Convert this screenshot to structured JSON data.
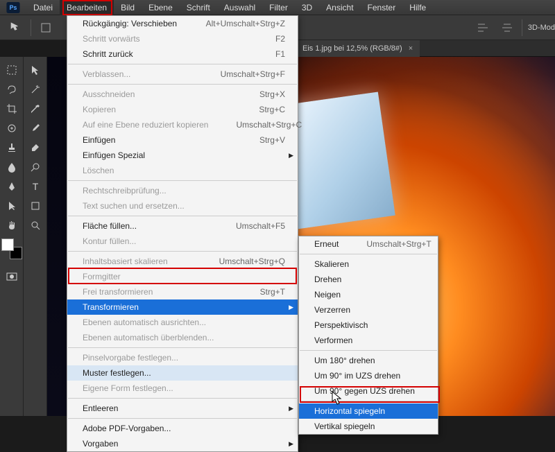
{
  "appLogo": "Ps",
  "menubar": [
    "Datei",
    "Bearbeiten",
    "Bild",
    "Ebene",
    "Schrift",
    "Auswahl",
    "Filter",
    "3D",
    "Ansicht",
    "Fenster",
    "Hilfe"
  ],
  "menubar_open_index": 1,
  "toolbar": {
    "mode_label": "3D-Mod"
  },
  "tabs": [
    {
      "label": "Eis 1.jpg bei 12,5% (RGB/8#)",
      "active": true
    }
  ],
  "editMenu": [
    {
      "label": "Rückgängig: Verschieben",
      "shortcut": "Alt+Umschalt+Strg+Z"
    },
    {
      "label": "Schritt vorwärts",
      "shortcut": "F2",
      "disabled": true
    },
    {
      "label": "Schritt zurück",
      "shortcut": "F1"
    },
    {
      "sep": true
    },
    {
      "label": "Verblassen...",
      "shortcut": "Umschalt+Strg+F",
      "disabled": true
    },
    {
      "sep": true
    },
    {
      "label": "Ausschneiden",
      "shortcut": "Strg+X",
      "disabled": true
    },
    {
      "label": "Kopieren",
      "shortcut": "Strg+C",
      "disabled": true
    },
    {
      "label": "Auf eine Ebene reduziert kopieren",
      "shortcut": "Umschalt+Strg+C",
      "disabled": true
    },
    {
      "label": "Einfügen",
      "shortcut": "Strg+V"
    },
    {
      "label": "Einfügen Spezial",
      "submenu": true
    },
    {
      "label": "Löschen",
      "disabled": true
    },
    {
      "sep": true
    },
    {
      "label": "Rechtschreibprüfung...",
      "disabled": true
    },
    {
      "label": "Text suchen und ersetzen...",
      "disabled": true
    },
    {
      "sep": true
    },
    {
      "label": "Fläche füllen...",
      "shortcut": "Umschalt+F5"
    },
    {
      "label": "Kontur füllen...",
      "disabled": true
    },
    {
      "sep": true
    },
    {
      "label": "Inhaltsbasiert skalieren",
      "shortcut": "Umschalt+Strg+Q",
      "disabled": true
    },
    {
      "label": "Formgitter",
      "disabled": true
    },
    {
      "label": "Frei transformieren",
      "shortcut": "Strg+T",
      "disabled": true
    },
    {
      "label": "Transformieren",
      "submenu": true,
      "selected": true
    },
    {
      "label": "Ebenen automatisch ausrichten...",
      "disabled": true
    },
    {
      "label": "Ebenen automatisch überblenden...",
      "disabled": true
    },
    {
      "sep": true
    },
    {
      "label": "Pinselvorgabe festlegen...",
      "disabled": true
    },
    {
      "label": "Muster festlegen...",
      "hover": true
    },
    {
      "label": "Eigene Form festlegen...",
      "disabled": true
    },
    {
      "sep": true
    },
    {
      "label": "Entleeren",
      "submenu": true
    },
    {
      "sep": true
    },
    {
      "label": "Adobe PDF-Vorgaben..."
    },
    {
      "label": "Vorgaben",
      "submenu": true
    }
  ],
  "transformSubmenu": [
    {
      "label": "Erneut",
      "shortcut": "Umschalt+Strg+T"
    },
    {
      "sep": true
    },
    {
      "label": "Skalieren"
    },
    {
      "label": "Drehen"
    },
    {
      "label": "Neigen"
    },
    {
      "label": "Verzerren"
    },
    {
      "label": "Perspektivisch"
    },
    {
      "label": "Verformen"
    },
    {
      "sep": true
    },
    {
      "label": "Um 180° drehen"
    },
    {
      "label": "Um 90° im UZS drehen"
    },
    {
      "label": "Um 90° gegen UZS drehen"
    },
    {
      "sep": true
    },
    {
      "label": "Horizontal spiegeln",
      "selected": true
    },
    {
      "label": "Vertikal spiegeln"
    }
  ]
}
